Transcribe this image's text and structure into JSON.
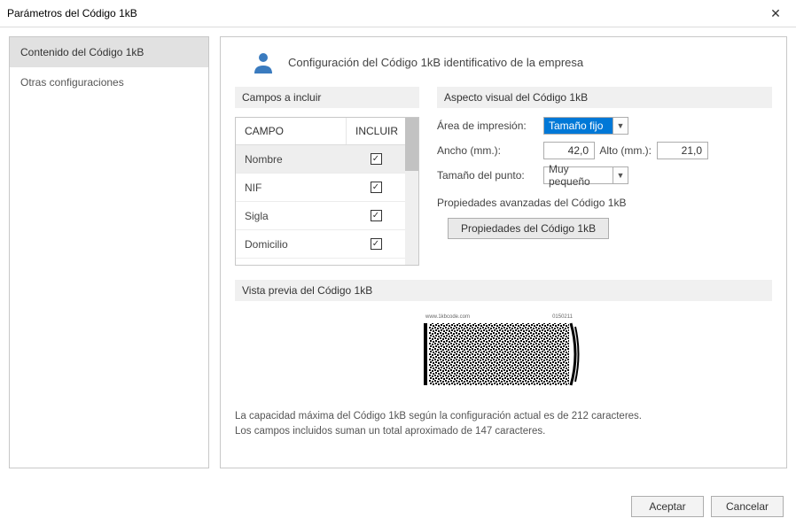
{
  "window": {
    "title": "Parámetros del Código 1kB"
  },
  "sidebar": {
    "items": [
      {
        "label": "Contenido del Código 1kB",
        "selected": true
      },
      {
        "label": "Otras configuraciones",
        "selected": false
      }
    ]
  },
  "header": {
    "title": "Configuración del Código 1kB identificativo de la empresa"
  },
  "fields_section": {
    "label": "Campos a incluir",
    "columns": {
      "campo": "CAMPO",
      "incluir": "INCLUIR"
    },
    "rows": [
      {
        "name": "Nombre",
        "included": true,
        "selected": true
      },
      {
        "name": "NIF",
        "included": true,
        "selected": false
      },
      {
        "name": "Sigla",
        "included": true,
        "selected": false
      },
      {
        "name": "Domicilio",
        "included": true,
        "selected": false
      }
    ]
  },
  "visual_section": {
    "label": "Aspecto visual del Código 1kB",
    "area_label": "Área de impresión:",
    "area_value": "Tamaño fijo",
    "ancho_label": "Ancho (mm.):",
    "ancho_value": "42,0",
    "alto_label": "Alto (mm.):",
    "alto_value": "21,0",
    "punto_label": "Tamaño del punto:",
    "punto_value": "Muy pequeño"
  },
  "advanced_section": {
    "label": "Propiedades avanzadas del Código 1kB",
    "button": "Propiedades del Código 1kB"
  },
  "preview_section": {
    "label": "Vista previa del Código 1kB",
    "barcode_caption_left": "www.1kbcode.com",
    "barcode_caption_right": "0150211"
  },
  "footer": {
    "line1": "La capacidad máxima del Código 1kB según la configuración actual es de 212 caracteres.",
    "line2": "Los campos incluidos suman un total aproximado de 147 caracteres."
  },
  "buttons": {
    "ok": "Aceptar",
    "cancel": "Cancelar"
  }
}
